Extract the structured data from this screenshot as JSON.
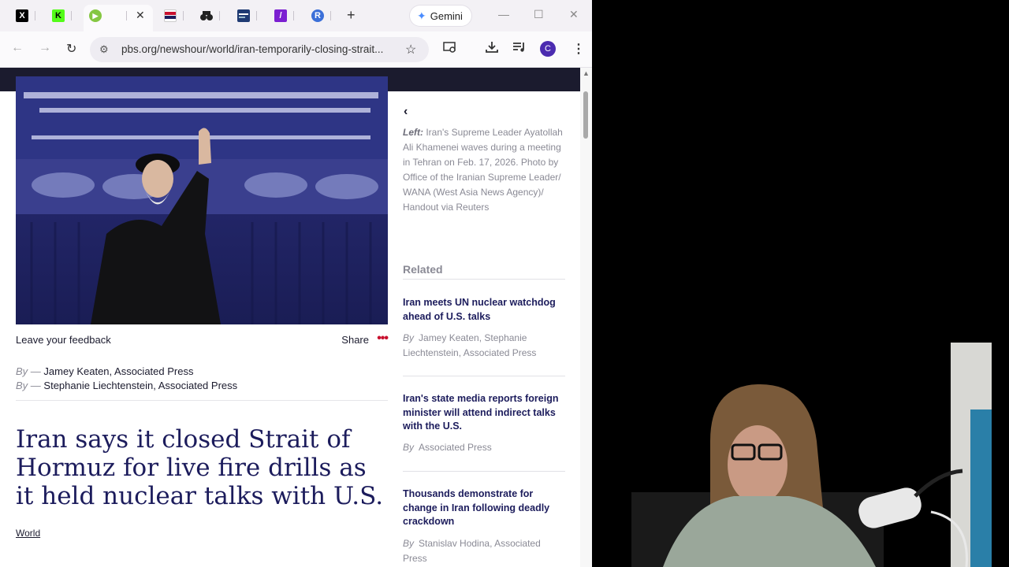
{
  "browser": {
    "tabs": [
      {
        "name": "x-tab",
        "glyph": "X"
      },
      {
        "name": "kick-tab",
        "glyph": "K"
      },
      {
        "name": "rumble-tab",
        "glyph": "▶"
      },
      {
        "name": "pbs-tab",
        "glyph": ""
      },
      {
        "name": "news-tab",
        "glyph": ""
      },
      {
        "name": "media-tab",
        "glyph": ""
      },
      {
        "name": "site-tab",
        "glyph": ""
      },
      {
        "name": "slash-tab",
        "glyph": "/"
      },
      {
        "name": "r-tab",
        "glyph": "R"
      }
    ],
    "gemini_label": "Gemini",
    "url": "pbs.org/newshour/world/iran-temporarily-closing-strait...",
    "profile_initial": "C"
  },
  "article": {
    "feedback": "Leave your feedback",
    "share": "Share",
    "bylines": [
      {
        "by": "By —",
        "author": "Jamey Keaten, Associated Press"
      },
      {
        "by": "By —",
        "author": "Stephanie Liechtenstein, Associated Press"
      }
    ],
    "headline": "Iran says it closed Strait of Hormuz for live fire drills as it held nuclear talks with U.S.",
    "category": "World"
  },
  "sidebar": {
    "caption_lead": "Left:",
    "caption_text": " Iran's Supreme Leader Ayatollah Ali Khamenei waves during a meeting in Tehran on Feb. 17, 2026. Photo by Office of the Iranian Supreme Leader/ WANA (West Asia News Agency)/ Handout via Reuters",
    "related_heading": "Related",
    "related": [
      {
        "title": "Iran meets UN nuclear watchdog ahead of U.S. talks",
        "by": "By",
        "authors": "Jamey Keaten, Stephanie Liechtenstein, Associated Press"
      },
      {
        "title": "Iran's state media reports foreign minister will attend indirect talks with the U.S.",
        "by": "By",
        "authors": "Associated Press"
      },
      {
        "title": "Thousands demonstrate for change in Iran following deadly crackdown",
        "by": "By",
        "authors": "Stanislav Hodina, Associated Press"
      }
    ]
  },
  "colors": {
    "headline": "#1c1c5c",
    "nav_strip": "#1b1b2e",
    "share_dots": "#c8102e"
  }
}
